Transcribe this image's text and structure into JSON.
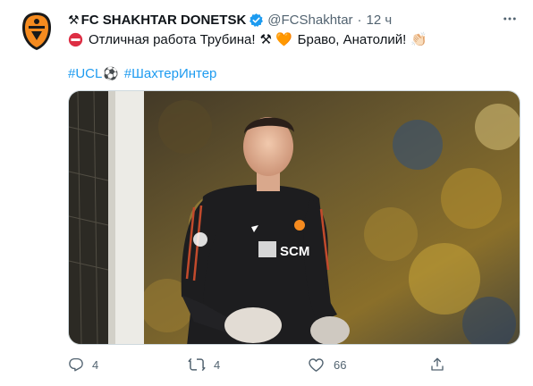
{
  "account": {
    "prefix_emoji": "⚒",
    "name": "FC SHAKHTAR DONETSK",
    "handle": "@FCShakhtar",
    "separator": "·",
    "time": "12 ч",
    "verified_color": "#1d9bf0"
  },
  "tweet": {
    "text_main": "Отличная работа Трубина!",
    "emoji_hammers": "⚒",
    "emoji_heart": "🧡",
    "text_after": "Браво, Анатолий!",
    "emoji_clap": "👏🏻",
    "hashtag_ucl": "#UCL",
    "emoji_ball": "⚽",
    "hashtag_match": "#ШахтерИнтер"
  },
  "media": {
    "jersey_sponsor": "SCM"
  },
  "actions": {
    "reply_count": "4",
    "retweet_count": "4",
    "like_count": "66"
  },
  "colors": {
    "link": "#1d9bf0",
    "secondary_text": "#536471",
    "brand_orange": "#f68b1f"
  }
}
